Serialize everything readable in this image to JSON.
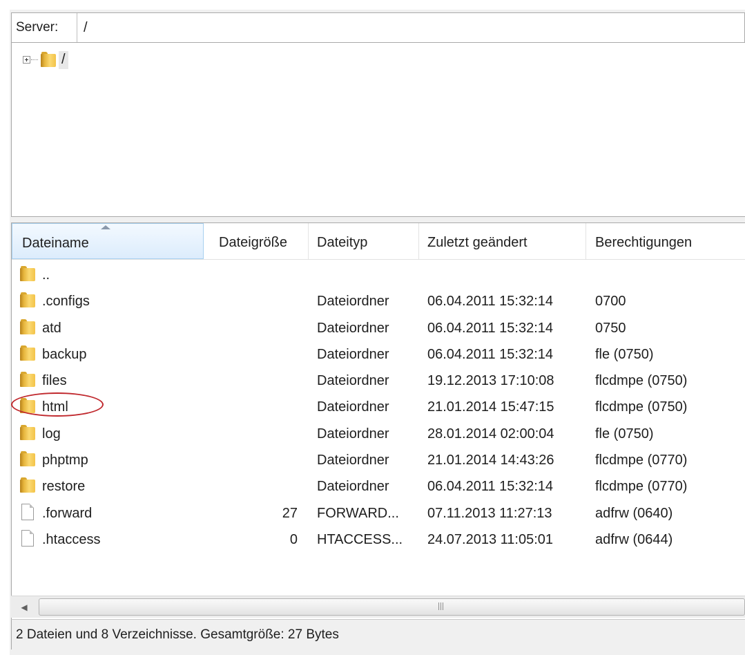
{
  "server_bar": {
    "label": "Server:",
    "path": "/"
  },
  "tree": {
    "root_label": "/"
  },
  "columns": {
    "name": "Dateiname",
    "size": "Dateigröße",
    "type": "Dateityp",
    "modified": "Zuletzt geändert",
    "permissions": "Berechtigungen"
  },
  "files": [
    {
      "icon": "folder-icon",
      "name": "..",
      "size": "",
      "type": "",
      "modified": "",
      "permissions": ""
    },
    {
      "icon": "folder-icon",
      "name": ".configs",
      "size": "",
      "type": "Dateiordner",
      "modified": "06.04.2011 15:32:14",
      "permissions": "0700"
    },
    {
      "icon": "folder-icon",
      "name": "atd",
      "size": "",
      "type": "Dateiordner",
      "modified": "06.04.2011 15:32:14",
      "permissions": "0750"
    },
    {
      "icon": "folder-icon",
      "name": "backup",
      "size": "",
      "type": "Dateiordner",
      "modified": "06.04.2011 15:32:14",
      "permissions": "fle (0750)"
    },
    {
      "icon": "folder-icon",
      "name": "files",
      "size": "",
      "type": "Dateiordner",
      "modified": "19.12.2013 17:10:08",
      "permissions": "flcdmpe (0750)"
    },
    {
      "icon": "folder-icon",
      "name": "html",
      "size": "",
      "type": "Dateiordner",
      "modified": "21.01.2014 15:47:15",
      "permissions": "flcdmpe (0750)"
    },
    {
      "icon": "folder-icon",
      "name": "log",
      "size": "",
      "type": "Dateiordner",
      "modified": "28.01.2014 02:00:04",
      "permissions": "fle (0750)"
    },
    {
      "icon": "folder-icon",
      "name": "phptmp",
      "size": "",
      "type": "Dateiordner",
      "modified": "21.01.2014 14:43:26",
      "permissions": "flcdmpe (0770)"
    },
    {
      "icon": "folder-icon",
      "name": "restore",
      "size": "",
      "type": "Dateiordner",
      "modified": "06.04.2011 15:32:14",
      "permissions": "flcdmpe (0770)"
    },
    {
      "icon": "file-icon",
      "name": ".forward",
      "size": "27",
      "type": "FORWARD...",
      "modified": "07.11.2013 11:27:13",
      "permissions": "adfrw (0640)"
    },
    {
      "icon": "file-icon",
      "name": ".htaccess",
      "size": "0",
      "type": "HTACCESS...",
      "modified": "24.07.2013 11:05:01",
      "permissions": "adfrw (0644)"
    }
  ],
  "status": {
    "text": "2 Dateien und 8 Verzeichnisse. Gesamtgröße: 27 Bytes"
  },
  "annotation": {
    "highlighted_item": "html",
    "color": "#c0282d"
  },
  "colors": {
    "header_sort_bg": "#dcecfc",
    "folder": "#f3c349"
  }
}
